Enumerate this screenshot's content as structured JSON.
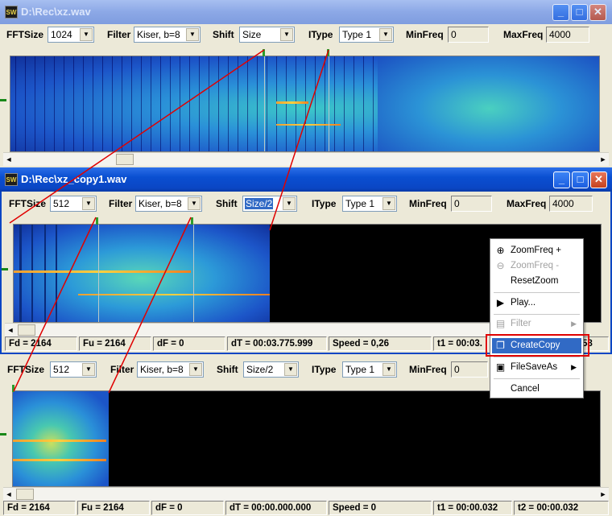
{
  "windows": [
    {
      "title": "D:\\Rec\\xz.wav",
      "app_icon": "SW",
      "toolbar": {
        "fftsize_label": "FFTSize",
        "fftsize_value": "1024",
        "filter_label": "Filter",
        "filter_value": "Kiser, b=8",
        "shift_label": "Shift",
        "shift_value": "Size",
        "itype_label": "IType",
        "itype_value": "Type 1",
        "minfreq_label": "MinFreq",
        "minfreq_value": "0",
        "maxfreq_label": "MaxFreq",
        "maxfreq_value": "4000"
      }
    },
    {
      "title": "D:\\Rec\\xz_copy1.wav",
      "app_icon": "SW",
      "toolbar": {
        "fftsize_label": "FFTSize",
        "fftsize_value": "512",
        "filter_label": "Filter",
        "filter_value": "Kiser, b=8",
        "shift_label": "Shift",
        "shift_value": "Size/2",
        "itype_label": "IType",
        "itype_value": "Type 1",
        "minfreq_label": "MinFreq",
        "minfreq_value": "0",
        "maxfreq_label": "MaxFreq",
        "maxfreq_value": "4000"
      },
      "status": {
        "fd": "Fd = 2164",
        "fu": "Fu = 2164",
        "df": "dF = 0",
        "dt": "dT = 00:03.775.999",
        "speed": "Speed = 0,26",
        "t1": "t1 = 00:03.",
        "t2_tail": "58"
      }
    },
    {
      "toolbar": {
        "fftsize_label": "FFTSize",
        "fftsize_value": "512",
        "filter_label": "Filter",
        "filter_value": "Kiser, b=8",
        "shift_label": "Shift",
        "shift_value": "Size/2",
        "itype_label": "IType",
        "itype_value": "Type 1",
        "minfreq_label": "MinFreq",
        "minfreq_value": "0"
      },
      "status": {
        "fd": "Fd = 2164",
        "fu": "Fu = 2164",
        "df": "dF = 0",
        "dt": "dT = 00:00.000.000",
        "speed": "Speed = 0",
        "t1": "t1 = 00:00.032",
        "t2": "t2 = 00:00.032"
      }
    }
  ],
  "context_menu": {
    "items": [
      {
        "label": "ZoomFreq +",
        "icon": "zoom-in-icon",
        "enabled": true
      },
      {
        "label": "ZoomFreq -",
        "icon": "zoom-out-icon",
        "enabled": false
      },
      {
        "label": "ResetZoom",
        "enabled": true
      },
      {
        "label": "Play...",
        "icon": "play-icon",
        "enabled": true
      },
      {
        "label": "Filter",
        "icon": "filter-icon",
        "enabled": false,
        "submenu": true
      },
      {
        "label": "CreateCopy",
        "icon": "copy-icon",
        "enabled": true,
        "highlighted": true
      },
      {
        "label": "FileSaveAs",
        "icon": "save-icon",
        "enabled": true,
        "submenu": true
      },
      {
        "label": "Cancel",
        "enabled": true
      }
    ]
  },
  "colors": {
    "titlebar_active": "#0a4fd1",
    "menu_highlight": "#316ac5",
    "annotation_red": "#e00000",
    "green_marker": "#2c9c2c"
  }
}
